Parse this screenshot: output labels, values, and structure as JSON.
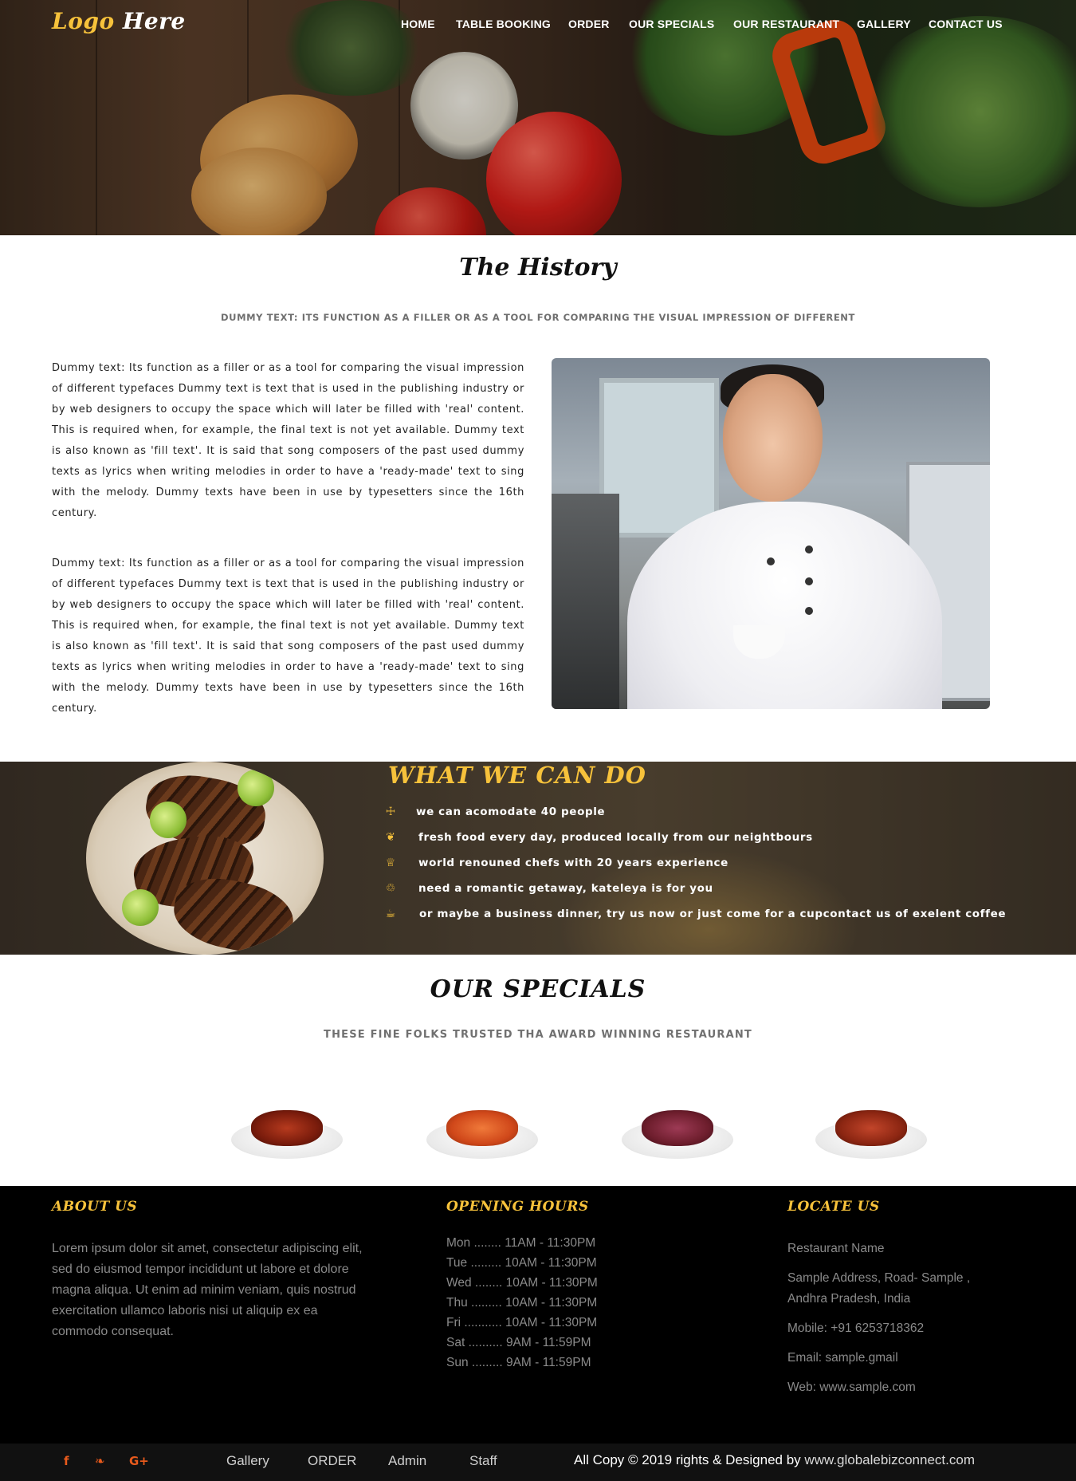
{
  "brand": {
    "logo_word1": "Logo",
    "logo_word2": "Here",
    "accent_color": "#f7c23b"
  },
  "nav": {
    "items": [
      "HOME",
      "TABLE BOOKING",
      "ORDER",
      "OUR SPECIALS",
      "OUR RESTAURANT",
      "GALLERY",
      "CONTACT US"
    ]
  },
  "history": {
    "title": "The History",
    "subtitle": "DUMMY TEXT: ITS FUNCTION AS A FILLER OR AS A TOOL FOR COMPARING THE VISUAL IMPRESSION OF DIFFERENT",
    "paragraphs": [
      "Dummy text: Its function as a filler or as a tool for comparing the visual impression of different typefaces Dummy text is text that is used in the publishing industry or by web designers to occupy the space which will later be filled with 'real' content. This is required when, for example, the final text is not yet available. Dummy text is also known as 'fill text'. It is said that song composers of the past used dummy texts as lyrics when writing melodies in order to have a 'ready-made' text to sing with the melody. Dummy texts have been in use by typesetters since the 16th century.",
      "Dummy text: Its function as a filler or as a tool for comparing the visual impression of different typefaces Dummy text is text that is used in the publishing industry or by web designers to occupy the space which will later be filled with 'real' content. This is required when, for example, the final text is not yet available. Dummy text is also known as 'fill text'. It is said that song composers of the past used dummy texts as lyrics when writing melodies in order to have a 'ready-made' text to sing with the melody. Dummy texts have been in use by typesetters since the 16th century."
    ]
  },
  "what_we_can_do": {
    "title": "WHAT WE CAN DO",
    "items": [
      {
        "icon": "cutlery-icon",
        "glyph": "☩",
        "text": "we can acomodate 40 people"
      },
      {
        "icon": "leaf-icon",
        "glyph": "❦",
        "text": "fresh food every day, produced locally from our neightbours"
      },
      {
        "icon": "trophy-icon",
        "glyph": "♕",
        "text": "world renouned chefs with 20 years experience"
      },
      {
        "icon": "glass-icon",
        "glyph": "♲",
        "text": "need a romantic getaway, kateleya is for you"
      },
      {
        "icon": "coffee-icon",
        "glyph": "☕",
        "text": "or maybe a business dinner, try us now or just come for a cupcontact us of exelent coffee"
      }
    ]
  },
  "specials": {
    "title": "OUR SPECIALS",
    "subtitle": "THESE FINE FOLKS TRUSTED THA AWARD WINNING RESTAURANT",
    "dishes": [
      "dish-1",
      "dish-2",
      "dish-3",
      "dish-4"
    ]
  },
  "footer": {
    "about": {
      "title": "ABOUT US",
      "text": "Lorem ipsum dolor sit amet, consectetur adipiscing elit, sed do eiusmod tempor incididunt ut labore et dolore magna aliqua. Ut enim ad minim veniam, quis nostrud exercitation ullamco laboris nisi ut aliquip ex ea commodo consequat."
    },
    "hours": {
      "title": "OPENING HOURS",
      "lines": [
        "Mon ........ 11AM - 11:30PM",
        "Tue ......... 10AM - 11:30PM",
        "Wed ........ 10AM - 11:30PM",
        "Thu ......... 10AM - 11:30PM",
        "Fri ........... 10AM - 11:30PM",
        "Sat .......... 9AM - 11:59PM",
        "Sun ......... 9AM - 11:59PM"
      ]
    },
    "locate": {
      "title": "LOCATE US",
      "name": "Restaurant Name",
      "address": "Sample Address, Road- Sample , Andhra Pradesh, India",
      "mobile": "Mobile: +91 6253718362",
      "email": "Email: sample.gmail",
      "web": "Web: www.sample.com"
    }
  },
  "bottom_bar": {
    "social": [
      {
        "icon": "facebook-icon",
        "glyph": "f"
      },
      {
        "icon": "twitter-icon",
        "glyph": "❧"
      },
      {
        "icon": "google-plus-icon",
        "glyph": "G+"
      }
    ],
    "links": [
      "Gallery",
      "ORDER",
      "Admin",
      "Staff"
    ],
    "copyright_prefix": "All Copy © 2019 rights & Designed by",
    "copyright_site": "www.globalebizconnect.com",
    "social_color": "#e85a1c"
  }
}
